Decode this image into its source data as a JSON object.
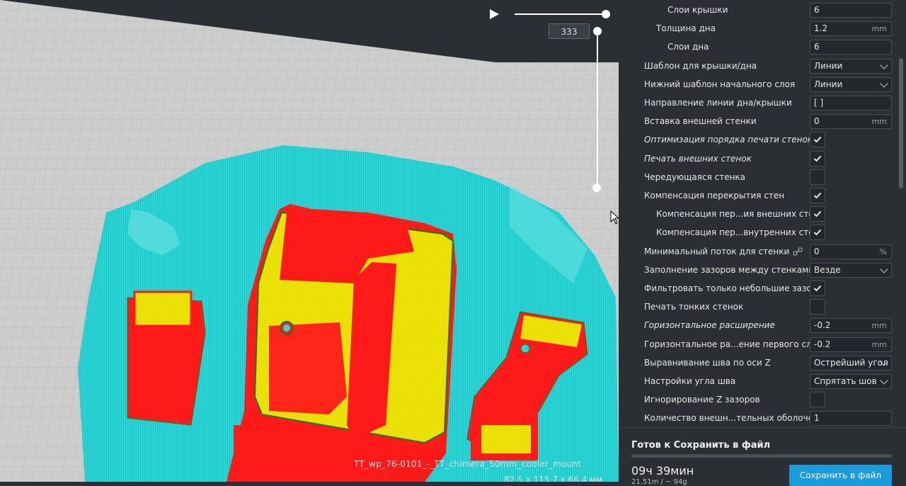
{
  "viewport": {
    "layer_number": "333",
    "model_name": "TT_wp_76-0101_-_TT_chimera_50mm_cooler_mount",
    "model_dims": "82.5 x 115.7 x 66.4 мм"
  },
  "settings": [
    {
      "label": "Слои крышки",
      "indent": 2,
      "type": "text",
      "value": "6",
      "unit": ""
    },
    {
      "label": "Толщина дна",
      "indent": 1,
      "type": "text",
      "value": "1.2",
      "unit": "mm"
    },
    {
      "label": "Слои дна",
      "indent": 2,
      "type": "text",
      "value": "6",
      "unit": ""
    },
    {
      "label": "Шаблон для крышки/дна",
      "indent": 0,
      "type": "dropdown",
      "value": "Линии"
    },
    {
      "label": "Нижний шаблон начального слоя",
      "indent": 0,
      "type": "dropdown",
      "value": "Линии"
    },
    {
      "label": "Направление линии дна/крышки",
      "indent": 0,
      "type": "text",
      "value": "[ ]",
      "unit": ""
    },
    {
      "label": "Вставка внешней стенки",
      "indent": 0,
      "type": "text",
      "value": "0",
      "unit": "mm"
    },
    {
      "label": "Оптимизация порядка печати стенок",
      "indent": 0,
      "type": "checkbox",
      "checked": true,
      "italic": true
    },
    {
      "label": "Печать внешних стенок",
      "indent": 0,
      "type": "checkbox",
      "checked": true,
      "italic": true
    },
    {
      "label": "Чередующаяся стенка",
      "indent": 0,
      "type": "checkbox",
      "checked": false
    },
    {
      "label": "Компенсация перекрытия стен",
      "indent": 0,
      "type": "checkbox",
      "checked": true
    },
    {
      "label": "Компенсация пер...ия внешних стен",
      "indent": 1,
      "type": "checkbox",
      "checked": true
    },
    {
      "label": "Компенсация пер...внутренних стен",
      "indent": 1,
      "type": "checkbox",
      "checked": true
    },
    {
      "label": "Минимальный поток для стенки",
      "indent": 0,
      "type": "text",
      "value": "0",
      "unit": "%",
      "link": true
    },
    {
      "label": "Заполнение зазоров между стенками",
      "indent": 0,
      "type": "dropdown",
      "value": "Везде"
    },
    {
      "label": "Фильтровать только небольшие зазоры",
      "indent": 0,
      "type": "checkbox",
      "checked": true
    },
    {
      "label": "Печать тонких стенок",
      "indent": 0,
      "type": "checkbox",
      "checked": false
    },
    {
      "label": "Горизонтальное расширение",
      "indent": 0,
      "type": "text",
      "value": "-0.2",
      "unit": "mm",
      "italic": true
    },
    {
      "label": "Горизонтальное ра...ение первого слоя",
      "indent": 0,
      "type": "text",
      "value": "-0.2",
      "unit": "mm"
    },
    {
      "label": "Выравнивание шва по оси Z",
      "indent": 0,
      "type": "dropdown",
      "value": "Острейший угол"
    },
    {
      "label": "Настройки угла шва",
      "indent": 0,
      "type": "dropdown",
      "value": "Спрятать шов"
    },
    {
      "label": "Игнорирование Z зазоров",
      "indent": 0,
      "type": "checkbox",
      "checked": false
    },
    {
      "label": "Количество внешн...тельных оболочек",
      "indent": 0,
      "type": "text",
      "value": "1",
      "unit": ""
    }
  ],
  "bottom": {
    "status": "Готов к Сохранить в файл",
    "time": "09ч 39мин",
    "usage": "21.51m / ~ 94g",
    "save_label": "Сохранить в файл"
  },
  "colors": {
    "accent": "#1a9bdb",
    "shell": "#2ad7d7",
    "wall": "#ff1a1a",
    "skin": "#f0e800",
    "bed": "#c9c9c9"
  }
}
